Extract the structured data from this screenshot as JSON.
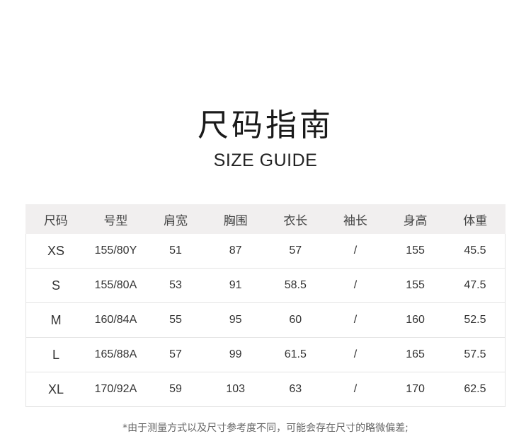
{
  "title": {
    "cn": "尺码指南",
    "en": "SIZE GUIDE"
  },
  "table": {
    "headers": [
      "尺码",
      "号型",
      "肩宽",
      "胸围",
      "衣长",
      "袖长",
      "身高",
      "体重"
    ],
    "rows": [
      [
        "XS",
        "155/80Y",
        "51",
        "87",
        "57",
        "/",
        "155",
        "45.5"
      ],
      [
        "S",
        "155/80A",
        "53",
        "91",
        "58.5",
        "/",
        "155",
        "47.5"
      ],
      [
        "M",
        "160/84A",
        "55",
        "95",
        "60",
        "/",
        "160",
        "52.5"
      ],
      [
        "L",
        "165/88A",
        "57",
        "99",
        "61.5",
        "/",
        "165",
        "57.5"
      ],
      [
        "XL",
        "170/92A",
        "59",
        "103",
        "63",
        "/",
        "170",
        "62.5"
      ]
    ]
  },
  "note": "*由于测量方式以及尺寸参考度不同，可能会存在尺寸的略微偏差;"
}
